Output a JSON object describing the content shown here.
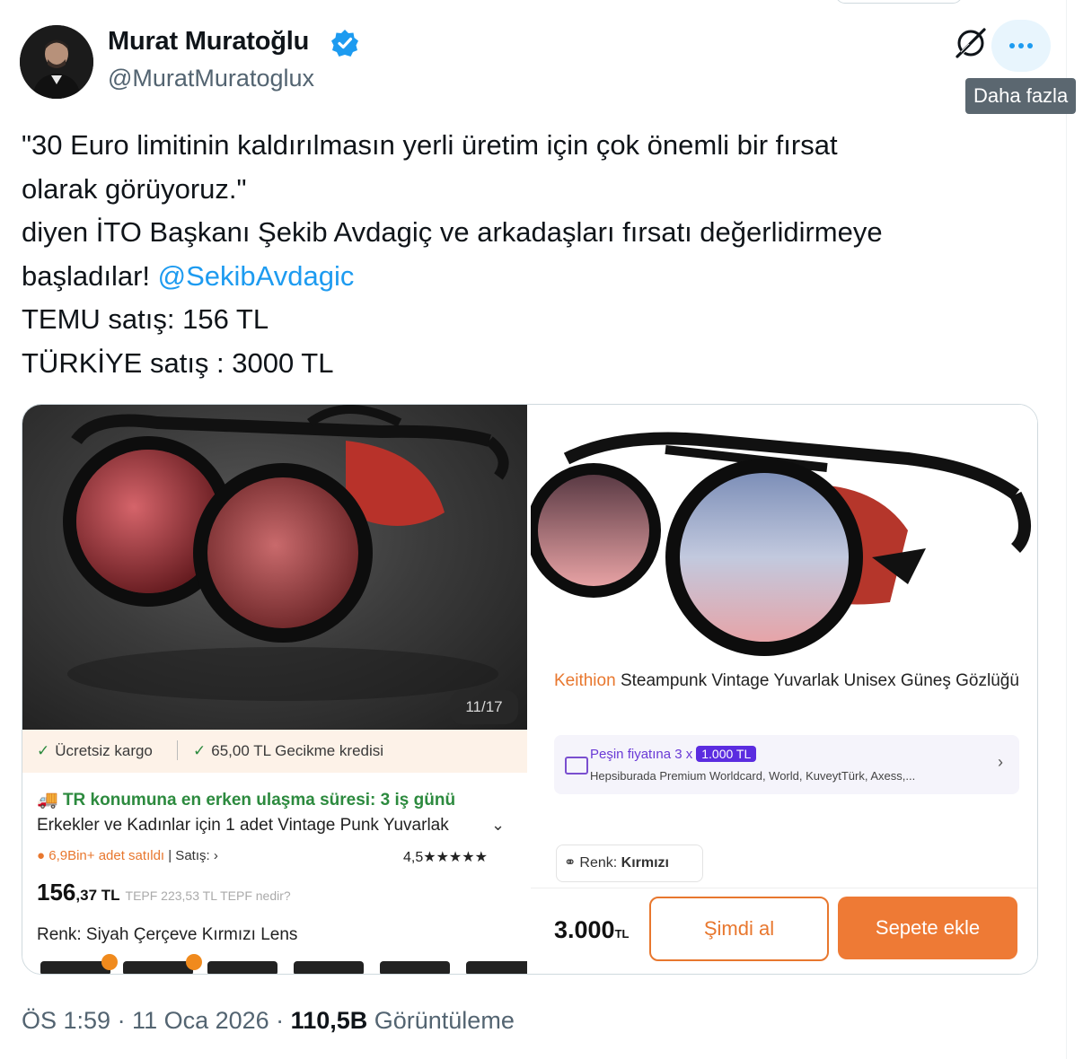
{
  "author": {
    "name": "Murat Muratoğlu",
    "handle": "@MuratMuratoglux"
  },
  "header_actions": {
    "tooltip": "Daha fazla"
  },
  "tweet": {
    "line1": "\"30 Euro limitinin kaldırılmasın yerli üretim için çok önemli bir fırsat",
    "line2": "olarak görüyoruz.\"",
    "line3": "diyen İTO Başkanı Şekib Avdagiç ve arkadaşları fırsatı değerlidirmeye",
    "line4_text": "başladılar! ",
    "line4_mention": "@SekibAvdagic",
    "line5": "TEMU satış: 156 TL",
    "line6": "TÜRKİYE satış : 3000 TL"
  },
  "left_image": {
    "counter": "11/17",
    "cargo_free": "Ücretsiz kargo",
    "cargo_credit": "65,00 TL Gecikme kredisi",
    "delivery": "TR konumuna en erken ulaşma süresi: 3 iş günü",
    "product": "Erkekler ve Kadınlar için 1 adet Vintage Punk Yuvarlak",
    "sold": "6,9Bin+ adet satıldı",
    "sold_rest": " | Satış:",
    "rating": "4,5★★★★★",
    "price_main": "156",
    "price_frac": ",37 TL",
    "price_tepf": "TEPF 223,53 TL TEPF nedir?",
    "color": "Renk: Siyah Çerçeve Kırmızı Lens"
  },
  "right_image": {
    "brand": "Keithion",
    "title": " Steampunk Vintage Yuvarlak Unisex Güneş Gözlüğü",
    "pesin_text": "Peşin fiyatına 3 x",
    "pesin_pill": "1.000 TL",
    "cards": "Hepsiburada Premium Worldcard, World, KuveytTürk, Axess,...",
    "renk_label": "Renk:",
    "renk_value": "Kırmızı",
    "price": "3.000",
    "price_unit": "TL",
    "buy_now": "Şimdi al",
    "add_to_cart": "Sepete ekle"
  },
  "footer": {
    "time": "ÖS 1:59 · 11 Oca 2026 · ",
    "views_count": "110,5B",
    "views_label": " Görüntüleme"
  },
  "colors": {
    "accent": "#1d9bf0",
    "orange": "#ee7a35"
  }
}
